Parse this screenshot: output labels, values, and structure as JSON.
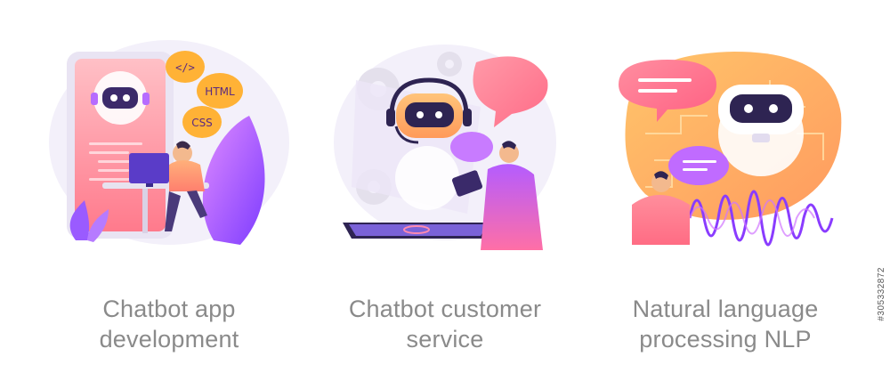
{
  "illustrations": [
    {
      "caption_line1": "Chatbot app",
      "caption_line2": "development",
      "code_badges": [
        "</>",
        "HTML",
        "CSS"
      ]
    },
    {
      "caption_line1": "Chatbot customer",
      "caption_line2": "service"
    },
    {
      "caption_line1": "Natural language",
      "caption_line2": "processing NLP"
    }
  ],
  "stock_id": "#305332872",
  "colors": {
    "pink": "#ff7b8f",
    "purple": "#9b52ff",
    "violet": "#c86bff",
    "lavender": "#eee7fb",
    "caption": "#8a8a8a"
  }
}
